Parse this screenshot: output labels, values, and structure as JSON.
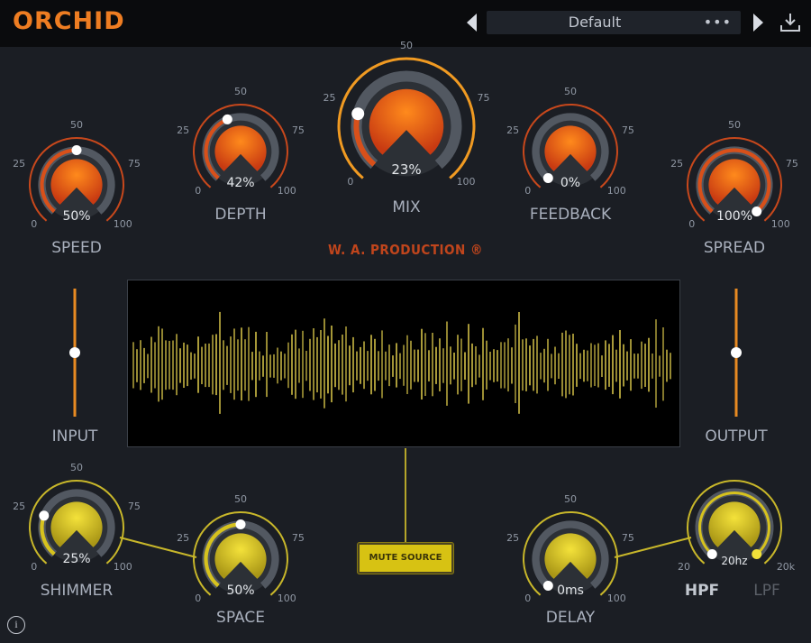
{
  "header": {
    "logo": "ORCHID",
    "preset_name": "Default",
    "preset_menu": "•••",
    "prev_icon": "chevron-left-icon",
    "next_icon": "chevron-right-icon",
    "download_icon": "download-icon"
  },
  "brand": "W. A. PRODUCTION ®",
  "knobs": {
    "speed": {
      "label": "SPEED",
      "value": "50%",
      "level": 0.5,
      "tick_min": "0",
      "tick_25": "25",
      "tick_50": "50",
      "tick_75": "75",
      "tick_max": "100"
    },
    "depth": {
      "label": "DEPTH",
      "value": "42%",
      "level": 0.42,
      "tick_min": "0",
      "tick_25": "25",
      "tick_50": "50",
      "tick_75": "75",
      "tick_max": "100"
    },
    "mix": {
      "label": "MIX",
      "value": "23%",
      "level": 0.23,
      "tick_min": "0",
      "tick_25": "25",
      "tick_50": "50",
      "tick_75": "75",
      "tick_max": "100"
    },
    "feedback": {
      "label": "FEEDBACK",
      "value": "0%",
      "level": 0.0,
      "tick_min": "0",
      "tick_25": "25",
      "tick_50": "50",
      "tick_75": "75",
      "tick_max": "100"
    },
    "spread": {
      "label": "SPREAD",
      "value": "100%",
      "level": 1.0,
      "tick_min": "0",
      "tick_25": "25",
      "tick_50": "50",
      "tick_75": "75",
      "tick_max": "100"
    },
    "shimmer": {
      "label": "SHIMMER",
      "value": "25%",
      "level": 0.25,
      "tick_min": "0",
      "tick_25": "25",
      "tick_50": "50",
      "tick_75": "75",
      "tick_max": "100"
    },
    "space": {
      "label": "SPACE",
      "value": "50%",
      "level": 0.5,
      "tick_min": "0",
      "tick_25": "25",
      "tick_50": "50",
      "tick_75": "75",
      "tick_max": "100"
    },
    "delay": {
      "label": "DELAY",
      "value": "0ms",
      "level": 0.0,
      "tick_min": "0",
      "tick_25": "25",
      "tick_50": "50",
      "tick_75": "75",
      "tick_max": "100"
    },
    "filter": {
      "value": "20hz",
      "hpf_label": "HPF",
      "lpf_label": "LPF",
      "tick_min": "20",
      "tick_max": "20k",
      "hpf_level": 0.0,
      "lpf_level": 1.0
    }
  },
  "sliders": {
    "input": {
      "label": "INPUT",
      "level": 0.5
    },
    "output": {
      "label": "OUTPUT",
      "level": 0.5
    }
  },
  "mute_source": "MUTE SOURCE",
  "info_icon_text": "i",
  "colors": {
    "accent_orange": "#ee7d22",
    "accent_yellow": "#d7c213",
    "background": "#1b1e24",
    "waveform": "#d9c64a"
  }
}
